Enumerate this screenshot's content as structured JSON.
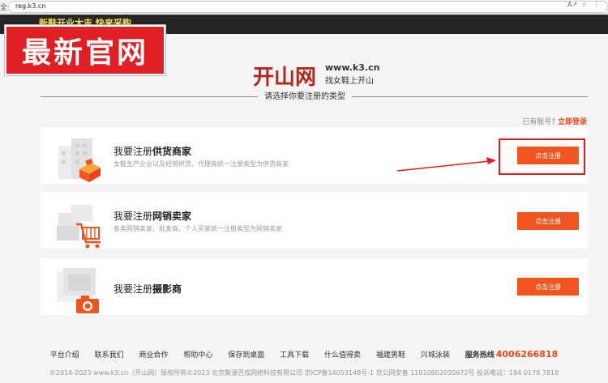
{
  "browser": {
    "url": "reg.k3.cn",
    "left_glyph": "全"
  },
  "topbar": {
    "promo_text": "新鞋开业大吉 快来采购"
  },
  "banner": {
    "text": "最新官网"
  },
  "logo": {
    "brand": "开山网",
    "domain": "www.k3.cn",
    "slogan": "找女鞋上开山"
  },
  "section": {
    "title": "请选择你要注册的类型"
  },
  "login": {
    "prompt": "已有账号?",
    "link": "立即登录"
  },
  "cards": [
    {
      "title_prefix": "我要注册",
      "title_bold": "供货商家",
      "description": "女鞋生产企业以及经销供货、代理商统一注册类型为供货商家",
      "button": "点击注册"
    },
    {
      "title_prefix": "我要注册",
      "title_bold": "网销卖家",
      "description": "各类网销卖家、批发商、个人买家统一注册类型为网销卖家",
      "button": "点击注册"
    },
    {
      "title_prefix": "我要注册",
      "title_bold": "摄影商",
      "description": "",
      "button": "点击注册"
    }
  ],
  "footer": {
    "links": [
      "平台介绍",
      "联系我们",
      "商业合作",
      "帮助中心",
      "保存到桌面",
      "工具下载",
      "什么值得卖",
      "福建男鞋",
      "兴城泳装"
    ],
    "hotline_label": "服务热线",
    "hotline_number": "4006266818",
    "copyright": "©2014-2023 www.k3.cn（开山网）版权所有©2023 北京聚源百成网络科技有限公司 京ICP备14053148号-1  京公网安备 11010802030672号  投诉电话：184 0178 7818"
  },
  "colors": {
    "accent": "#f25420",
    "brand_red": "#b3261c",
    "banner_red": "#e01f24"
  }
}
